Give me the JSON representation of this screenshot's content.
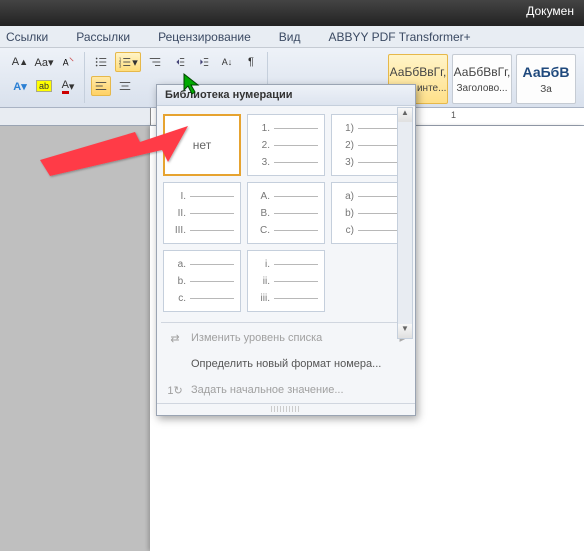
{
  "titlebar": {
    "doc": "Докумен"
  },
  "tabs": {
    "links": "Ссылки",
    "mailings": "Рассылки",
    "review": "Рецензирование",
    "view": "Вид",
    "abbyy": "ABBYY PDF Transformer+"
  },
  "styles": {
    "s0": {
      "preview": "АаБбВвГг,",
      "label": "¶ Без инте..."
    },
    "s1": {
      "preview": "АаБбВвГг,",
      "label": "Заголово..."
    },
    "s2": {
      "preview": "АаБбВ",
      "label": "За"
    }
  },
  "ruler": {
    "tick1": "1"
  },
  "dropdown": {
    "title": "Библиотека нумерации",
    "none": "нет",
    "fmt": {
      "decimal": [
        "1.",
        "2.",
        "3."
      ],
      "decimal_paren": [
        "1)",
        "2)",
        "3)"
      ],
      "roman_upper": [
        "I.",
        "II.",
        "III."
      ],
      "alpha_upper": [
        "A.",
        "B.",
        "C."
      ],
      "alpha_lower_paren": [
        "a)",
        "b)",
        "c)"
      ],
      "alpha_lower_dot": [
        "a.",
        "b.",
        "c."
      ],
      "roman_lower": [
        "i.",
        "ii.",
        "iii."
      ]
    },
    "items": {
      "change_level": "Изменить уровень списка",
      "define_format": "Определить новый формат номера...",
      "set_value": "Задать начальное значение..."
    }
  }
}
